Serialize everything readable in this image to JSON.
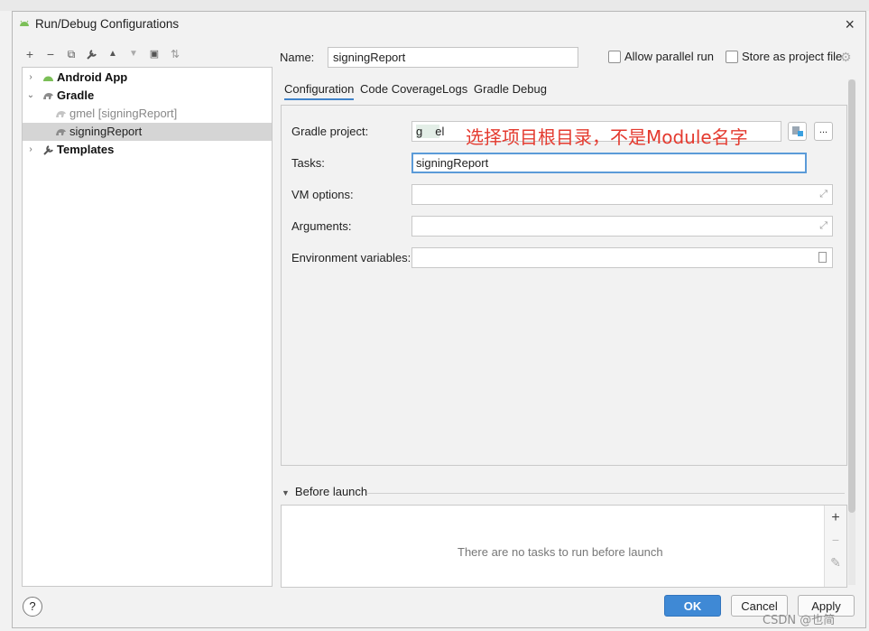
{
  "window": {
    "title": "Run/Debug Configurations",
    "close": "×"
  },
  "toolbar": {
    "add": "+",
    "remove": "−",
    "copy": "⧉",
    "edit": "🔧",
    "up": "▲",
    "down": "▼",
    "folder": "▣",
    "sort": "⇅"
  },
  "tree": {
    "items": [
      {
        "label": "Android App",
        "chevron": "›"
      },
      {
        "label": "Gradle",
        "chevron": "⌄"
      },
      {
        "label": "gmel [signingReport]"
      },
      {
        "label": "signingReport"
      },
      {
        "label": "Templates",
        "chevron": "›"
      }
    ]
  },
  "form": {
    "name_label": "Name:",
    "name_value": "signingReport",
    "allow_parallel_label": "Allow parallel run",
    "store_project_label": "Store as project file"
  },
  "tabs": [
    "Configuration",
    "Code Coverage",
    "Logs",
    "Gradle Debug"
  ],
  "config": {
    "gradle_project_label": "Gradle project:",
    "gradle_project_value": "g",
    "gradle_project_value_tail": "el",
    "annotation": "选择项目根目录，不是Module名字",
    "tasks_label": "Tasks:",
    "tasks_value": "signingReport",
    "vm_options_label": "VM options:",
    "vm_options_value": "",
    "arguments_label": "Arguments:",
    "arguments_value": "",
    "env_label": "Environment variables:",
    "env_value": "",
    "browse_btn": "..."
  },
  "before_launch": {
    "label": "Before launch",
    "empty_text": "There are no tasks to run before launch",
    "add": "+",
    "remove": "−",
    "edit": "✎"
  },
  "buttons": {
    "help": "?",
    "ok": "OK",
    "cancel": "Cancel",
    "apply": "Apply"
  },
  "watermark": "CSDN @也简",
  "colors": {
    "accent": "#3f89d5",
    "annotation": "#e43a2f",
    "android_green": "#7bbf57"
  }
}
